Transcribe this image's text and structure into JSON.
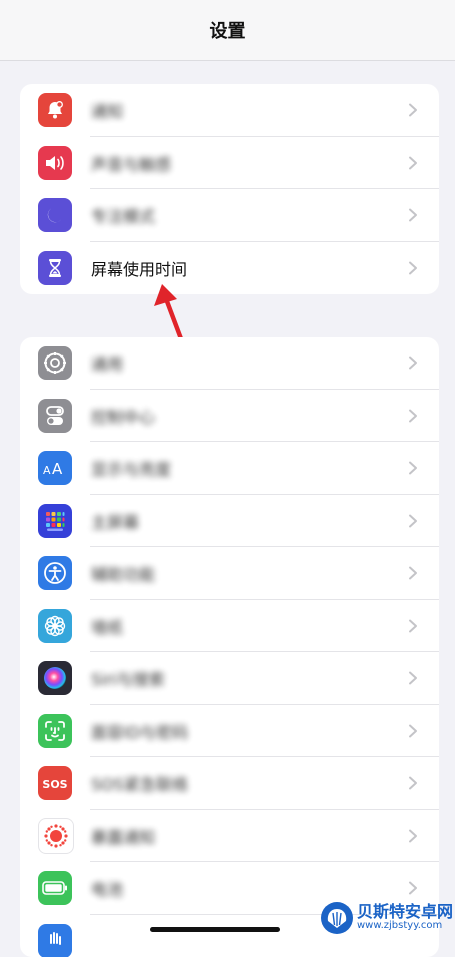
{
  "nav": {
    "title": "设置"
  },
  "groups": [
    {
      "items": [
        {
          "label": "通知",
          "icon": "bell-icon",
          "color": "#e5453b",
          "blurred": true
        },
        {
          "label": "声音与触感",
          "icon": "speaker-icon",
          "color": "#e6394f",
          "blurred": true
        },
        {
          "label": "专注模式",
          "icon": "moon-icon",
          "color": "#5b4fd6",
          "blurred": true
        },
        {
          "label": "屏幕使用时间",
          "icon": "hourglass-icon",
          "color": "#5b4fd6",
          "blurred": false
        }
      ]
    },
    {
      "items": [
        {
          "label": "通用",
          "icon": "gear-icon",
          "color": "#8e8e93",
          "blurred": true
        },
        {
          "label": "控制中心",
          "icon": "toggles-icon",
          "color": "#8e8e93",
          "blurred": true
        },
        {
          "label": "显示与亮度",
          "icon": "text-size-icon",
          "color": "#2f7ae5",
          "blurred": true
        },
        {
          "label": "主屏幕",
          "icon": "home-grid-icon",
          "color": "#3540d8",
          "blurred": true
        },
        {
          "label": "辅助功能",
          "icon": "accessibility-icon",
          "color": "#2f7ae5",
          "blurred": true
        },
        {
          "label": "墙纸",
          "icon": "flower-icon",
          "color": "#35a6db",
          "blurred": true
        },
        {
          "label": "Siri与搜索",
          "icon": "siri-icon",
          "color": "#2a2a35",
          "blurred": true
        },
        {
          "label": "面容ID与密码",
          "icon": "face-id-icon",
          "color": "#3cc35a",
          "blurred": true
        },
        {
          "label": "SOS紧急联络",
          "icon": "sos-icon",
          "color": "#e5453b",
          "blurred": true
        },
        {
          "label": "暴露通知",
          "icon": "exposure-icon",
          "color": "#ffffff",
          "blurred": true
        },
        {
          "label": "电池",
          "icon": "battery-icon",
          "color": "#3cc35a",
          "blurred": true
        }
      ]
    }
  ],
  "partial_row": {
    "icon": "privacy-hand-icon",
    "color": "#2f7ae5"
  },
  "annotation": {
    "icon": "red-arrow-icon",
    "color": "#e0242a"
  },
  "watermark": {
    "title": "贝斯特安卓网",
    "url": "www.zjbstyy.com"
  }
}
